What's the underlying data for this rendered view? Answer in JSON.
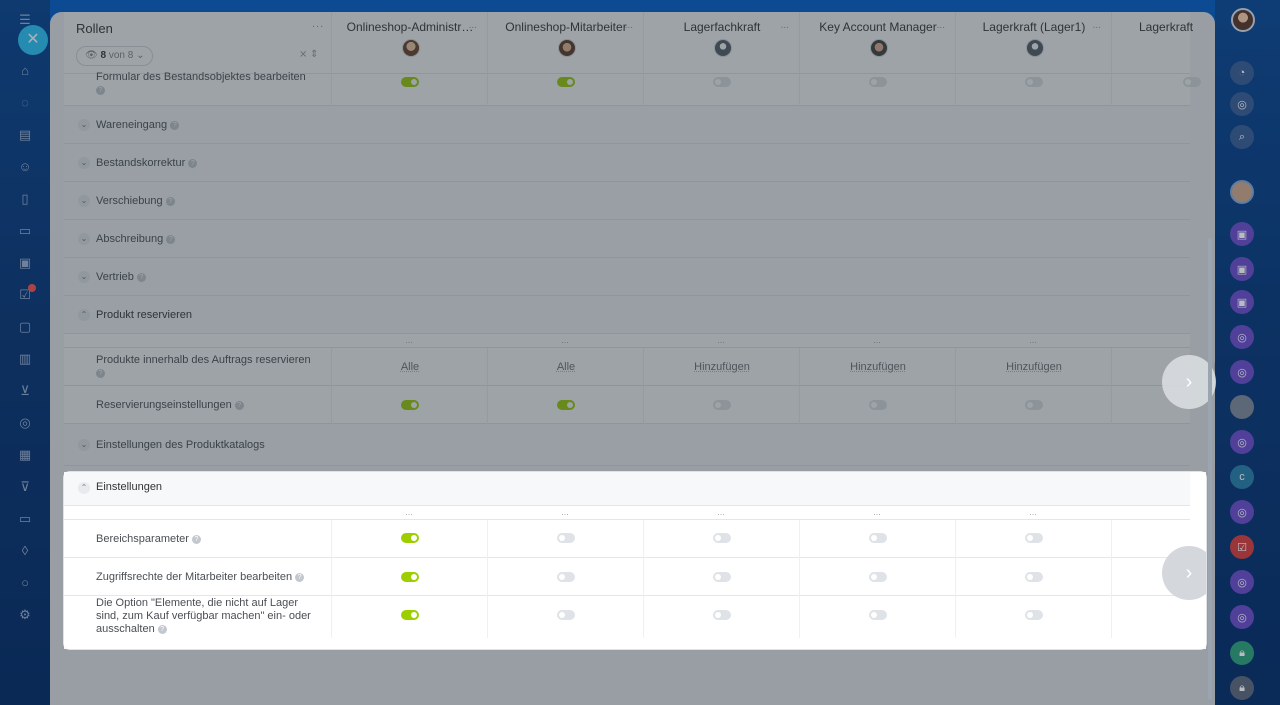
{
  "roles_header": {
    "title": "Rollen",
    "count_current": "8",
    "count_total": "von 8"
  },
  "columns": [
    {
      "name": "Onlineshop-Administr…",
      "avatar": "female"
    },
    {
      "name": "Onlineshop-Mitarbeiter",
      "avatar": "male"
    },
    {
      "name": "Lagerfachkraft",
      "avatar": "placeholder"
    },
    {
      "name": "Key Account Manager",
      "avatar": "male2"
    },
    {
      "name": "Lagerkraft (Lager1)",
      "avatar": "placeholder"
    },
    {
      "name": "Lagerkraft",
      "avatar": "male3"
    }
  ],
  "top_row": {
    "label": "Formular des Bestandsobjektes bearbeiten",
    "toggles": [
      true,
      true,
      false,
      false,
      false,
      false
    ]
  },
  "sections": [
    {
      "label": "Wareneingang"
    },
    {
      "label": "Bestandskorrektur"
    },
    {
      "label": "Verschiebung"
    },
    {
      "label": "Abschreibung"
    },
    {
      "label": "Vertrieb"
    },
    {
      "label": "Produkt reservieren"
    }
  ],
  "reserve_rows": [
    {
      "label": "Produkte innerhalb des Auftrags reservieren",
      "values": [
        "Alle",
        "Alle",
        "Hinzufügen",
        "Hinzufügen",
        "Hinzufügen",
        "Hinzu"
      ]
    },
    {
      "label": "Reservierungseinstellungen",
      "toggles": [
        true,
        true,
        false,
        false,
        false,
        false
      ]
    }
  ],
  "catalog_section": {
    "label": "Einstellungen des Produktkatalogs"
  },
  "settings_section": {
    "label": "Einstellungen"
  },
  "settings_rows": [
    {
      "label": "Bereichsparameter",
      "toggles": [
        true,
        false,
        false,
        false,
        false,
        false
      ]
    },
    {
      "label": "Zugriffsrechte der Mitarbeiter bearbeiten",
      "toggles": [
        true,
        false,
        false,
        false,
        false,
        false
      ]
    },
    {
      "label_lines": [
        "Die Option \"Elemente, die nicht auf Lager",
        "sind, zum Kauf verfügbar machen\" ein- oder",
        "ausschalten"
      ],
      "toggles": [
        true,
        false,
        false,
        false,
        false,
        false
      ]
    }
  ],
  "dots": "...",
  "colors": {
    "toggle_on": "#9dcf00",
    "toggle_off": "#dfe3e7",
    "accent": "#2fc6f6"
  }
}
